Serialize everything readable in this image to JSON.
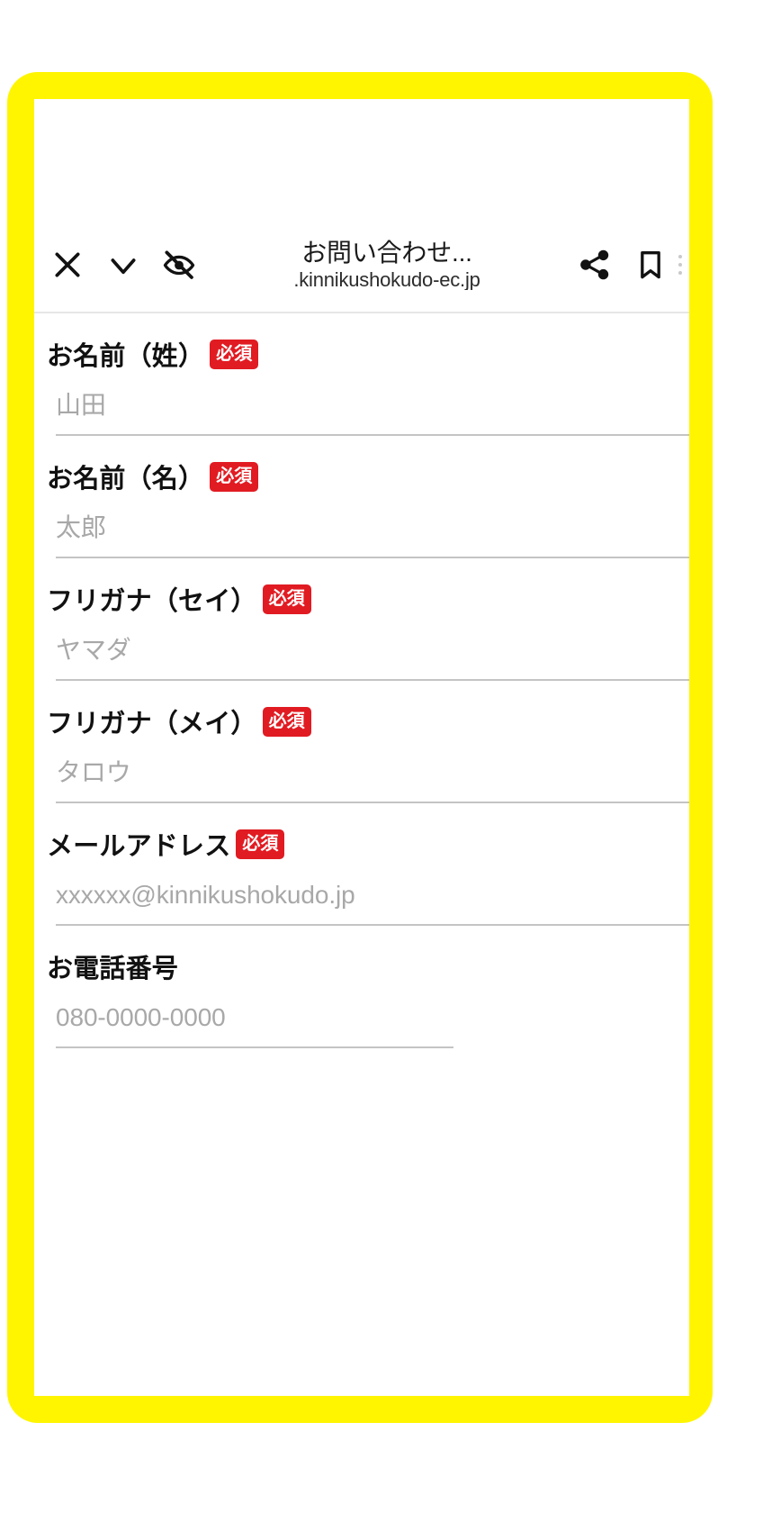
{
  "frame": {
    "accent_color": "#FFF500",
    "screen_background": "#FFFFFF"
  },
  "browser": {
    "toolbar": {
      "close_label": "×",
      "close_icon": "close-icon",
      "collapse_icon": "chevron-down-icon",
      "reader_hidden_icon": "eye-slash-icon",
      "share_icon": "share-icon",
      "bookmark_icon": "bookmark-icon",
      "overflow_icon": "more-vertical-icon",
      "page_title": "お問い合わせ...",
      "page_url": ".kinnikushokudo-ec.jp"
    }
  },
  "form": {
    "required_badge_label": "必須",
    "required_badge_color": "#e11b22",
    "fields": [
      {
        "name": "last-name",
        "label": "お名前（姓）",
        "required": true,
        "placeholder": "山田",
        "value": "",
        "underline": "full"
      },
      {
        "name": "first-name",
        "label": "お名前（名）",
        "required": true,
        "placeholder": "太郎",
        "value": "",
        "underline": "full"
      },
      {
        "name": "furigana-sei",
        "label": "フリガナ（セイ）",
        "required": true,
        "placeholder": "ヤマダ",
        "value": "",
        "underline": "full"
      },
      {
        "name": "furigana-mei",
        "label": "フリガナ（メイ）",
        "required": true,
        "placeholder": "タロウ",
        "value": "",
        "underline": "full"
      },
      {
        "name": "email",
        "label": "メールアドレス",
        "required": true,
        "placeholder": "xxxxxx@kinnikushokudo.jp",
        "value": "",
        "underline": "full"
      },
      {
        "name": "phone",
        "label": "お電話番号",
        "required": false,
        "placeholder": "080-0000-0000",
        "value": "",
        "underline": "short"
      }
    ]
  }
}
